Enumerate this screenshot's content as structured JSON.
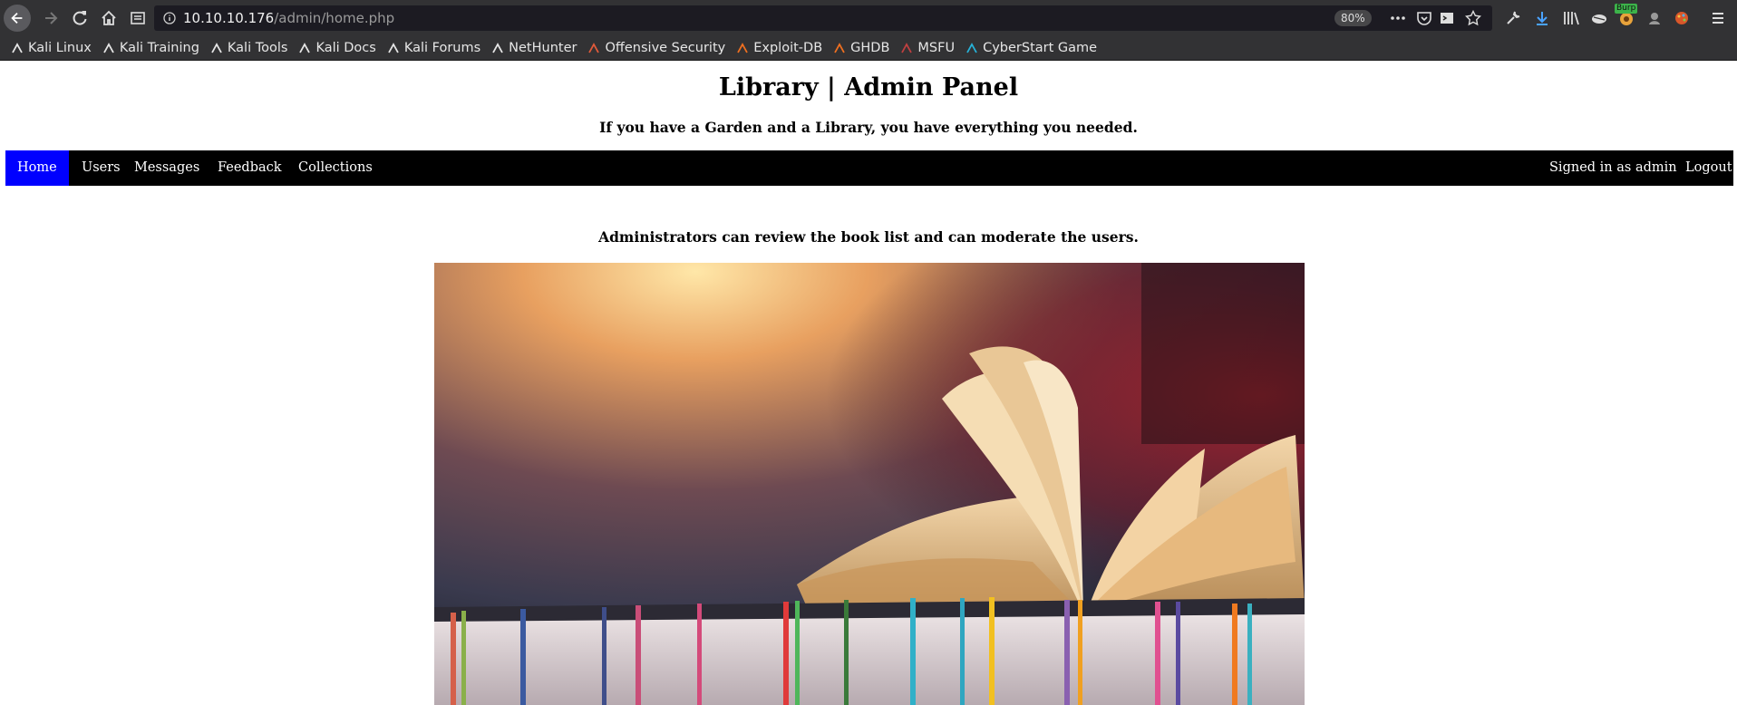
{
  "browser": {
    "url_host": "10.10.10.176",
    "url_path": "/admin/home.php",
    "zoom": "80%",
    "burp_badge": "Burp",
    "bookmarks": [
      {
        "label": "Kali Linux",
        "icon": "kali-dragon-icon"
      },
      {
        "label": "Kali Training",
        "icon": "kali-dragon-icon"
      },
      {
        "label": "Kali Tools",
        "icon": "kali-dragon-icon"
      },
      {
        "label": "Kali Docs",
        "icon": "kali-dragon-icon"
      },
      {
        "label": "Kali Forums",
        "icon": "kali-dragon-icon"
      },
      {
        "label": "NetHunter",
        "icon": "nethunter-icon"
      },
      {
        "label": "Offensive Security",
        "icon": "offsec-icon"
      },
      {
        "label": "Exploit-DB",
        "icon": "exploitdb-icon"
      },
      {
        "label": "GHDB",
        "icon": "ghdb-icon"
      },
      {
        "label": "MSFU",
        "icon": "msfu-icon"
      },
      {
        "label": "CyberStart Game",
        "icon": "cyberstart-icon"
      }
    ]
  },
  "page": {
    "title": "Library | Admin Panel",
    "subtitle": "If you have a Garden and a Library, you have everything you needed.",
    "nav_left": [
      "Home",
      "Users",
      "Messages",
      "Feedback",
      "Collections"
    ],
    "nav_right": [
      "Signed in as admin",
      "Logout"
    ],
    "intro": "Administrators can review the book list and can moderate the users."
  },
  "colors": {
    "nav_bg": "#000000",
    "nav_active": "#0000ff",
    "browser_chrome": "#323234"
  }
}
